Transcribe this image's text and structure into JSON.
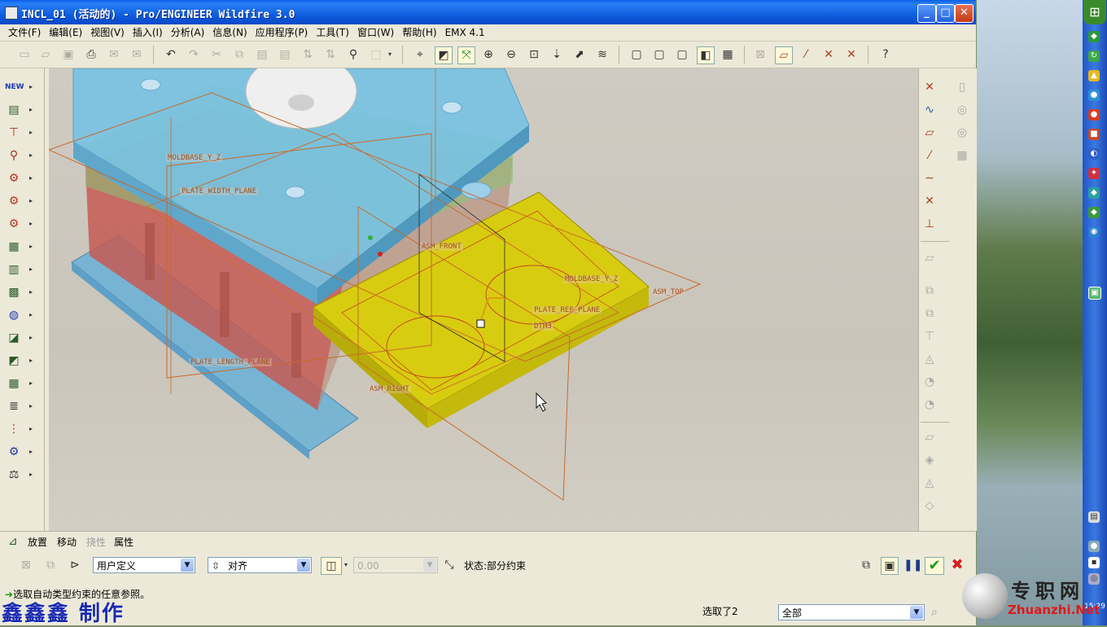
{
  "window": {
    "title": "INCL_01 (活动的) - Pro/ENGINEER Wildfire 3.0"
  },
  "menu": [
    "文件(F)",
    "编辑(E)",
    "视图(V)",
    "插入(I)",
    "分析(A)",
    "信息(N)",
    "应用程序(P)",
    "工具(T)",
    "窗口(W)",
    "帮助(H)",
    "EMX 4.1"
  ],
  "datum_labels": {
    "moldbase_y_z_1": "MOLDBASE_Y_Z",
    "plate_width": "PLATE_WIDTH_PLANE",
    "asm_front": "ASM_FRONT",
    "moldbase_y_z_2": "MOLDBASE_Y_Z",
    "asm_top": "ASM_TOP",
    "plate_ref": "PLATE_REF_PLANE",
    "dtm3": "DTM3",
    "plate_length": "PLATE_LENGTH_PLANE",
    "asm_right": "ASM_RIGHT"
  },
  "dashboard": {
    "tabs": {
      "placement": "放置",
      "move": "移动",
      "flexibility": "挠性",
      "properties": "属性"
    },
    "constraint_set": "用户定义",
    "constraint_type": "对齐",
    "offset_value": "0.00",
    "status_label": "状态:部分约束"
  },
  "status": {
    "message": "选取自动类型约束的任意参照。",
    "selected": "选取了2",
    "filter": "全部"
  },
  "watermark": {
    "author": "鑫鑫鑫 制作",
    "site_cn": "专职网",
    "site_en": "Zhuanzhi.Net"
  },
  "tray": {
    "clock": "15:29"
  }
}
